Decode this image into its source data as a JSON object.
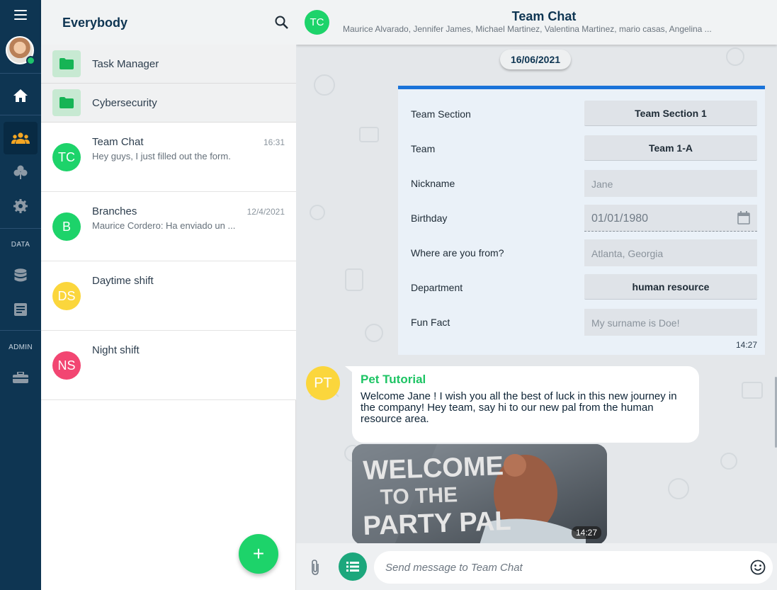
{
  "rail": {
    "sections": [
      {
        "label": "DATA"
      },
      {
        "label": "ADMIN"
      }
    ],
    "icons": [
      "menu-icon",
      "home-icon",
      "groups-icon",
      "club-icon",
      "settings-icon",
      "database-icon",
      "form-icon",
      "toolbox-icon"
    ]
  },
  "list": {
    "title": "Everybody",
    "folders": [
      {
        "label": "Task Manager"
      },
      {
        "label": "Cybersecurity"
      }
    ],
    "chats": [
      {
        "initials": "TC",
        "name": "Team Chat",
        "time": "16:31",
        "preview": "Hey guys, I just filled out the form.",
        "color": "#1dd36a"
      },
      {
        "initials": "B",
        "name": "Branches",
        "time": "12/4/2021",
        "preview": "Maurice Cordero: Ha enviado un ...",
        "color": "#1dd36a"
      },
      {
        "initials": "DS",
        "name": "Daytime shift",
        "time": "",
        "preview": "",
        "color": "#fbd63c"
      },
      {
        "initials": "NS",
        "name": "Night shift",
        "time": "",
        "preview": "",
        "color": "#f24672"
      }
    ],
    "fab_label": "+"
  },
  "conversation": {
    "initials": "TC",
    "title": "Team Chat",
    "members": "Maurice Alvarado, Jennifer James, Michael Martinez, Valentina Martinez, mario casas, Angelina ...",
    "date_chip": "16/06/2021",
    "form": {
      "rows": [
        {
          "label": "Team Section",
          "value": "Team Section 1",
          "kind": "button"
        },
        {
          "label": "Team",
          "value": "Team 1-A",
          "kind": "button"
        },
        {
          "label": "Nickname",
          "value": "Jane",
          "kind": "field"
        },
        {
          "label": "Birthday",
          "value": "01/01/1980",
          "kind": "date"
        },
        {
          "label": "Where are you from?",
          "value": "Atlanta, Georgia",
          "kind": "field"
        },
        {
          "label": "Department",
          "value": "human resource",
          "kind": "button"
        },
        {
          "label": "Fun Fact",
          "value": "My surname is Doe!",
          "kind": "field"
        }
      ],
      "time": "14:27"
    },
    "message": {
      "initials": "PT",
      "sender": "Pet Tutorial",
      "text": "Welcome Jane ! I wish you all the best of luck in this new journey in the company! Hey team, say hi to our new pal from the human resource area.",
      "gif_text": [
        "WELCOME",
        "TO THE",
        "PARTY PAL"
      ],
      "gif_time": "14:27"
    },
    "composer": {
      "placeholder": "Send message to Team Chat"
    }
  },
  "colors": {
    "rail": "#0e3552",
    "accent_green": "#1dd36a",
    "form_border": "#1a73d9",
    "sender_green": "#1dc464"
  }
}
